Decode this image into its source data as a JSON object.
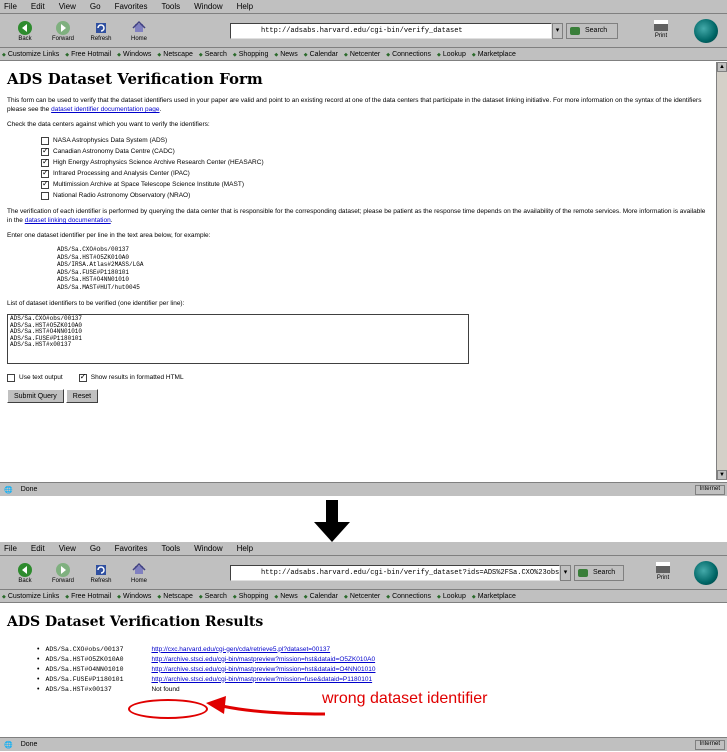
{
  "top_window": {
    "menu": [
      "File",
      "Edit",
      "View",
      "Go",
      "Favorites",
      "Tools",
      "Window",
      "Help"
    ],
    "toolbar": {
      "buttons": [
        "Back",
        "Forward",
        "Refresh",
        "Home"
      ],
      "url": "http://adsabs.harvard.edu/cgi-bin/verify_dataset",
      "search_label": "Search",
      "print_label": "Print"
    },
    "links": [
      "Customize Links",
      "Free Hotmail",
      "Windows",
      "Netscape",
      "Search",
      "Shopping",
      "News",
      "Calendar",
      "Netcenter",
      "Connections",
      "Lookup",
      "Marketplace"
    ],
    "page": {
      "title": "ADS Dataset Verification Form",
      "intro": "This form can be used to verify that the dataset identifiers used in your paper are valid and point to an existing record at one of the data centers that participate in the dataset linking initiative. For more information on the syntax of the identifiers please see the",
      "intro_link": "dataset identifier documentation page",
      "choose_label": "Check the data centers against which you want to verify the identifiers:",
      "options": [
        {
          "label": "NASA Astrophysics Data System (ADS)",
          "checked": false
        },
        {
          "label": "Canadian Astronomy Data Centre (CADC)",
          "checked": true
        },
        {
          "label": "High Energy Astrophysics Science Archive Research Center (HEASARC)",
          "checked": true
        },
        {
          "label": "Infrared Processing and Analysis Center (IPAC)",
          "checked": true
        },
        {
          "label": "Multimission Archive at Space Telescope Science Institute (MAST)",
          "checked": true
        },
        {
          "label": "National Radio Astronomy Observatory (NRAO)",
          "checked": false
        }
      ],
      "note": "The verification of each identifier is performed by querying the data center that is responsible for the corresponding dataset; please be patient as the response time depends on the availability of the remote services. More information is available in the",
      "note_link": "dataset linking documentation",
      "example_label": "Enter one dataset identifier per line in the text area below, for example:",
      "examples": "ADS/Sa.CXO#obs/00137\nADS/Sa.HST#O5ZK010A0\nADS/IRSA.Atlas#2MASS/LGA\nADS/Sa.FUSE#P1180101\nADS/Sa.HST#O4NN01010\nADS/Sa.MAST#HUT/hut0045",
      "textarea_label": "List of dataset identifiers to be verified (one identifier per line):",
      "textarea_value": "ADS/Sa.CXO#obs/00137\nADS/Sa.HST#O5ZK010A0\nADS/Sa.HST#O4NN01010\nADS/Sa.FUSE#P1180101\nADS/Sa.HST#x00137",
      "format_options": [
        {
          "label": "Use text output",
          "checked": false
        },
        {
          "label": "Show results in formatted HTML",
          "checked": true
        }
      ],
      "submit_label": "Submit Query",
      "reset_label": "Reset"
    },
    "status": "Done",
    "zone": "Internet"
  },
  "bottom_window": {
    "menu": [
      "File",
      "Edit",
      "View",
      "Go",
      "Favorites",
      "Tools",
      "Window",
      "Help"
    ],
    "toolbar": {
      "buttons": [
        "Back",
        "Forward",
        "Refresh",
        "Home"
      ],
      "url": "http://adsabs.harvard.edu/cgi-bin/verify_dataset?ids=ADS%2FSa.CXO%23obs",
      "search_label": "Search",
      "print_label": "Print"
    },
    "links": [
      "Customize Links",
      "Free Hotmail",
      "Windows",
      "Netscape",
      "Search",
      "Shopping",
      "News",
      "Calendar",
      "Netcenter",
      "Connections",
      "Lookup",
      "Marketplace"
    ],
    "page": {
      "title": "ADS Dataset Verification Results",
      "results": [
        {
          "id": "ADS/Sa.CXO#obs/00137",
          "status": "http://cxc.harvard.edu/cgi-gen/cda/retrieve5.pl?dataset=00137"
        },
        {
          "id": "ADS/Sa.HST#O5ZK010A0",
          "status": "http://archive.stsci.edu/cgi-bin/mastpreview?mission=hst&dataid=O5ZK010A0"
        },
        {
          "id": "ADS/Sa.HST#O4NN01010",
          "status": "http://archive.stsci.edu/cgi-bin/mastpreview?mission=hst&dataid=O4NN01010"
        },
        {
          "id": "ADS/Sa.FUSE#P1180101",
          "status": "http://archive.stsci.edu/cgi-bin/mastpreview?mission=fuse&dataid=P1180101"
        },
        {
          "id": "ADS/Sa.HST#x00137",
          "status": "Not found"
        }
      ]
    },
    "status": "Done",
    "zone": "Internet"
  },
  "annotation": {
    "callout_text": "wrong dataset identifier",
    "color": "#e00000"
  }
}
